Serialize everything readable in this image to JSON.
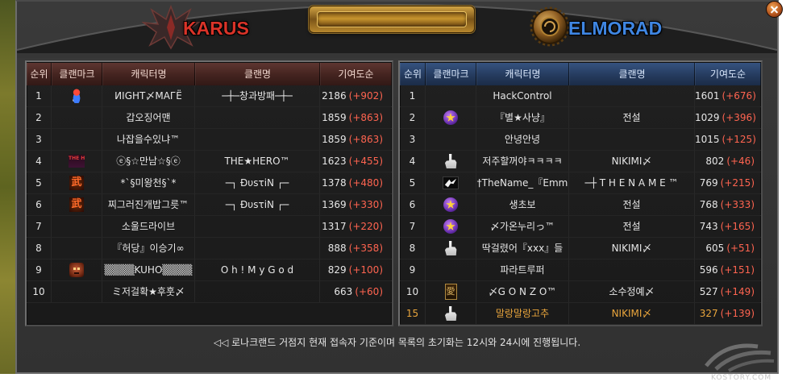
{
  "header": {
    "karus_title": "KARUS",
    "elmorad_title": "ELMORAD"
  },
  "icons": {
    "close_button": "close-icon",
    "karus_emblem": "karus-emblem-icon",
    "elmorad_emblem": "elmorad-emblem-icon",
    "watermark_logo": "kostory-logo-icon"
  },
  "colors": {
    "karus": "#d93328",
    "elmorad": "#3f86e2",
    "delta": "#ff6450",
    "highlight": "#e9a53c",
    "title_plate": "#c8952e"
  },
  "karus": {
    "columns": [
      "순위",
      "클랜마크",
      "캐릭터명",
      "클랜명",
      "기여도순"
    ],
    "rows": [
      {
        "rank": "1",
        "mark": "creature-emblem-icon",
        "character": "ИIGНТ〆МAГЁ",
        "clan": "─┼─창과방패─┼─",
        "score": "2186",
        "delta": "(+902)"
      },
      {
        "rank": "2",
        "character": "갑오징어맨",
        "clan": "",
        "score": "1859",
        "delta": "(+863)"
      },
      {
        "rank": "3",
        "character": "나잡을수있냐™",
        "clan": "",
        "score": "1859",
        "delta": "(+863)"
      },
      {
        "rank": "4",
        "mark": "the-hero-emblem-icon",
        "mark_text": "THE HERO",
        "character": "ⓔ§☆만남☆§ⓔ",
        "clan": "THE★HERO™",
        "score": "1623",
        "delta": "(+455)"
      },
      {
        "rank": "5",
        "mark": "wu-emblem-icon",
        "mark_text": "武",
        "character": "*`§미왕천§`*",
        "clan": "─┐ ĐυѕτiΝ ┌─",
        "score": "1378",
        "delta": "(+480)"
      },
      {
        "rank": "6",
        "mark": "wu-emblem-icon",
        "mark_text": "武",
        "character": "찌그러진개밥그릇™",
        "clan": "─┐ ĐυѕτiΝ ┌─",
        "score": "1369",
        "delta": "(+330)"
      },
      {
        "rank": "7",
        "character": "소울드라이브",
        "clan": "",
        "score": "1317",
        "delta": "(+220)"
      },
      {
        "rank": "8",
        "character": "『허당』이승기∞",
        "clan": "",
        "score": "888",
        "delta": "(+358)"
      },
      {
        "rank": "9",
        "mark": "face-emblem-icon",
        "character": "▒▒▒▒KUHO▒▒▒▒",
        "clan": "O h ! M y G o d",
        "score": "829",
        "delta": "(+100)"
      },
      {
        "rank": "10",
        "character": "ミ저걸확★후훗〆",
        "clan": "",
        "score": "663",
        "delta": "(+60)"
      }
    ]
  },
  "elmorad": {
    "columns": [
      "순위",
      "클랜마크",
      "캐릭터명",
      "클랜명",
      "기여도순"
    ],
    "rows": [
      {
        "rank": "1",
        "character": "HackControl",
        "clan": "",
        "score": "1601",
        "delta": "(+676)"
      },
      {
        "rank": "2",
        "mark": "star-emblem-icon",
        "character": "『별★사냥』",
        "clan": "전설",
        "score": "1029",
        "delta": "(+396)"
      },
      {
        "rank": "3",
        "character": "안녕안녕",
        "clan": "",
        "score": "1015",
        "delta": "(+125)"
      },
      {
        "rank": "4",
        "mark": "hand-emblem-icon",
        "character": "저주할꺼야ㅋㅋㅋㅋ",
        "clan": "NIKIMI〆",
        "score": "802",
        "delta": "(+46)"
      },
      {
        "rank": "5",
        "mark": "bird-emblem-icon",
        "character": "†TheName_『Emm",
        "clan": "─┼ T H E N A M E ™",
        "score": "769",
        "delta": "(+215)"
      },
      {
        "rank": "6",
        "mark": "star-emblem-icon",
        "character": "생초보",
        "clan": "전설",
        "score": "768",
        "delta": "(+333)"
      },
      {
        "rank": "7",
        "mark": "star-emblem-icon",
        "character": "〆가온누리っ™",
        "clan": "전설",
        "score": "743",
        "delta": "(+165)"
      },
      {
        "rank": "8",
        "mark": "hand-emblem-icon",
        "character": "딱걸렸어『xxx』들",
        "clan": "NIKIMI〆",
        "score": "605",
        "delta": "(+51)"
      },
      {
        "rank": "9",
        "character": "파라트루퍼",
        "clan": "",
        "score": "596",
        "delta": "(+151)"
      },
      {
        "rank": "10",
        "mark": "ai-emblem-icon",
        "mark_text": "愛",
        "character": "〆G O N Z O™",
        "clan": "소수정예〆",
        "score": "527",
        "delta": "(+149)"
      },
      {
        "rank": "15",
        "mark": "hand-emblem-icon",
        "character": "말랑말랑고추",
        "clan": "NIKIMI〆",
        "score": "327",
        "delta": "(+139)",
        "highlighted": true
      }
    ]
  },
  "notice": "◁◁ 로나크랜드 거점지 현재 접속자 기준이며 목록의 초기화는 12시와 24시에 진행됩니다.",
  "watermark": "KOSTORY.COM"
}
